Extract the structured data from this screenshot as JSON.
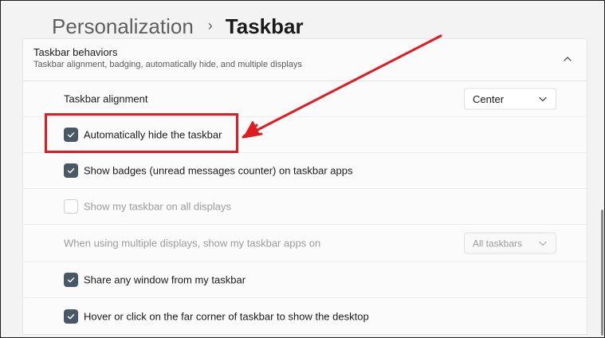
{
  "breadcrumb": {
    "parent": "Personalization",
    "separator": "›",
    "current": "Taskbar"
  },
  "section": {
    "title": "Taskbar behaviors",
    "subtitle": "Taskbar alignment, badging, automatically hide, and multiple displays",
    "collapse_icon": "chevron-up-icon",
    "expanded": true
  },
  "settings": {
    "alignment": {
      "label": "Taskbar alignment",
      "value": "Center",
      "icon": "chevron-down-icon"
    },
    "auto_hide": {
      "label": "Automatically hide the taskbar",
      "checked": true
    },
    "badges": {
      "label": "Show badges (unread messages counter) on taskbar apps",
      "checked": true
    },
    "all_displays": {
      "label": "Show my taskbar on all displays",
      "checked": false,
      "disabled": true
    },
    "multi_display": {
      "label": "When using multiple displays, show my taskbar apps on",
      "value": "All taskbars",
      "disabled": true,
      "icon": "chevron-down-icon"
    },
    "share_window": {
      "label": "Share any window from my taskbar",
      "checked": true
    },
    "far_corner": {
      "label": "Hover or click on the far corner of taskbar to show the desktop",
      "checked": true
    }
  },
  "colors": {
    "checkbox_checked": "#4a5866",
    "annotation_red": "#e01b22",
    "disabled_text": "#9c9c9c"
  }
}
